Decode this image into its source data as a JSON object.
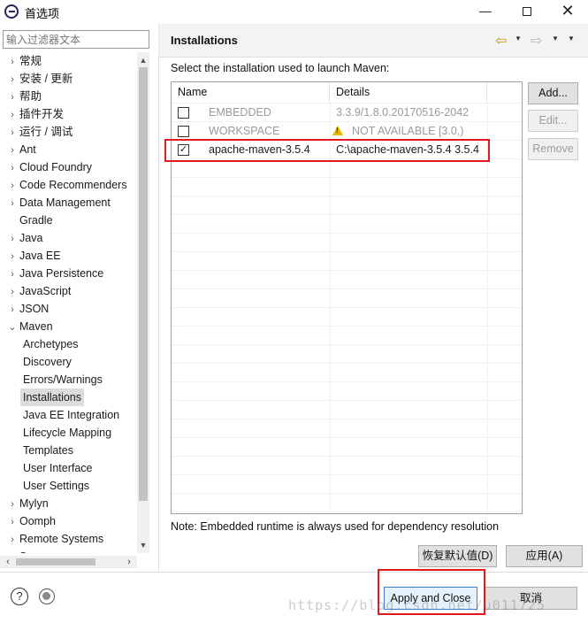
{
  "window": {
    "title": "首选项",
    "minimize_glyph": "—",
    "close_glyph": "✕"
  },
  "sidebar": {
    "filter_placeholder": "输入过滤器文本",
    "items": [
      {
        "label": "常规",
        "arrow": "›"
      },
      {
        "label": "安装 / 更新",
        "arrow": "›"
      },
      {
        "label": "帮助",
        "arrow": "›"
      },
      {
        "label": "插件开发",
        "arrow": "›"
      },
      {
        "label": "运行 / 调试",
        "arrow": "›"
      },
      {
        "label": "Ant",
        "arrow": "›"
      },
      {
        "label": "Cloud Foundry",
        "arrow": "›"
      },
      {
        "label": "Code Recommenders",
        "arrow": "›"
      },
      {
        "label": "Data Management",
        "arrow": "›"
      },
      {
        "label": "Gradle",
        "arrow": ""
      },
      {
        "label": "Java",
        "arrow": "›"
      },
      {
        "label": "Java EE",
        "arrow": "›"
      },
      {
        "label": "Java Persistence",
        "arrow": "›"
      },
      {
        "label": "JavaScript",
        "arrow": "›"
      },
      {
        "label": "JSON",
        "arrow": "›"
      },
      {
        "label": "Maven",
        "arrow": "⌄"
      },
      {
        "label": "Archetypes",
        "arrow": ""
      },
      {
        "label": "Discovery",
        "arrow": ""
      },
      {
        "label": "Errors/Warnings",
        "arrow": ""
      },
      {
        "label": "Installations",
        "arrow": ""
      },
      {
        "label": "Java EE Integration",
        "arrow": ""
      },
      {
        "label": "Lifecycle Mapping",
        "arrow": ""
      },
      {
        "label": "Templates",
        "arrow": ""
      },
      {
        "label": "User Interface",
        "arrow": ""
      },
      {
        "label": "User Settings",
        "arrow": ""
      },
      {
        "label": "Mylyn",
        "arrow": "›"
      },
      {
        "label": "Oomph",
        "arrow": "›"
      },
      {
        "label": "Remote Systems",
        "arrow": "›"
      },
      {
        "label": "Server",
        "arrow": "›"
      }
    ],
    "selected": "Installations"
  },
  "page": {
    "title": "Installations",
    "instruction": "Select the installation used to launch Maven:",
    "columns": [
      "Name",
      "Details"
    ],
    "rows": [
      {
        "checked": false,
        "name": "EMBEDDED",
        "details": "3.3.9/1.8.0.20170516-2042",
        "disabled": true,
        "warning": false
      },
      {
        "checked": false,
        "name": "WORKSPACE",
        "details": "NOT AVAILABLE [3.0,)",
        "disabled": true,
        "warning": true
      },
      {
        "checked": true,
        "name": "apache-maven-3.5.4",
        "details": "C:\\apache-maven-3.5.4 3.5.4",
        "disabled": false,
        "warning": false
      }
    ],
    "buttons": {
      "add": "Add...",
      "edit": "Edit...",
      "remove": "Remove"
    },
    "note": "Note: Embedded runtime is always used for dependency resolution",
    "restore_defaults": "恢复默认值(D)",
    "apply": "应用(A)"
  },
  "footer": {
    "apply_and_close": "Apply and Close",
    "cancel": "取消",
    "watermark": "https://blog.csdn.net/u011725"
  },
  "icons": {
    "back": "⇦",
    "forward": "⇨",
    "dropdown": "▼",
    "help": "?",
    "check": "✓"
  }
}
